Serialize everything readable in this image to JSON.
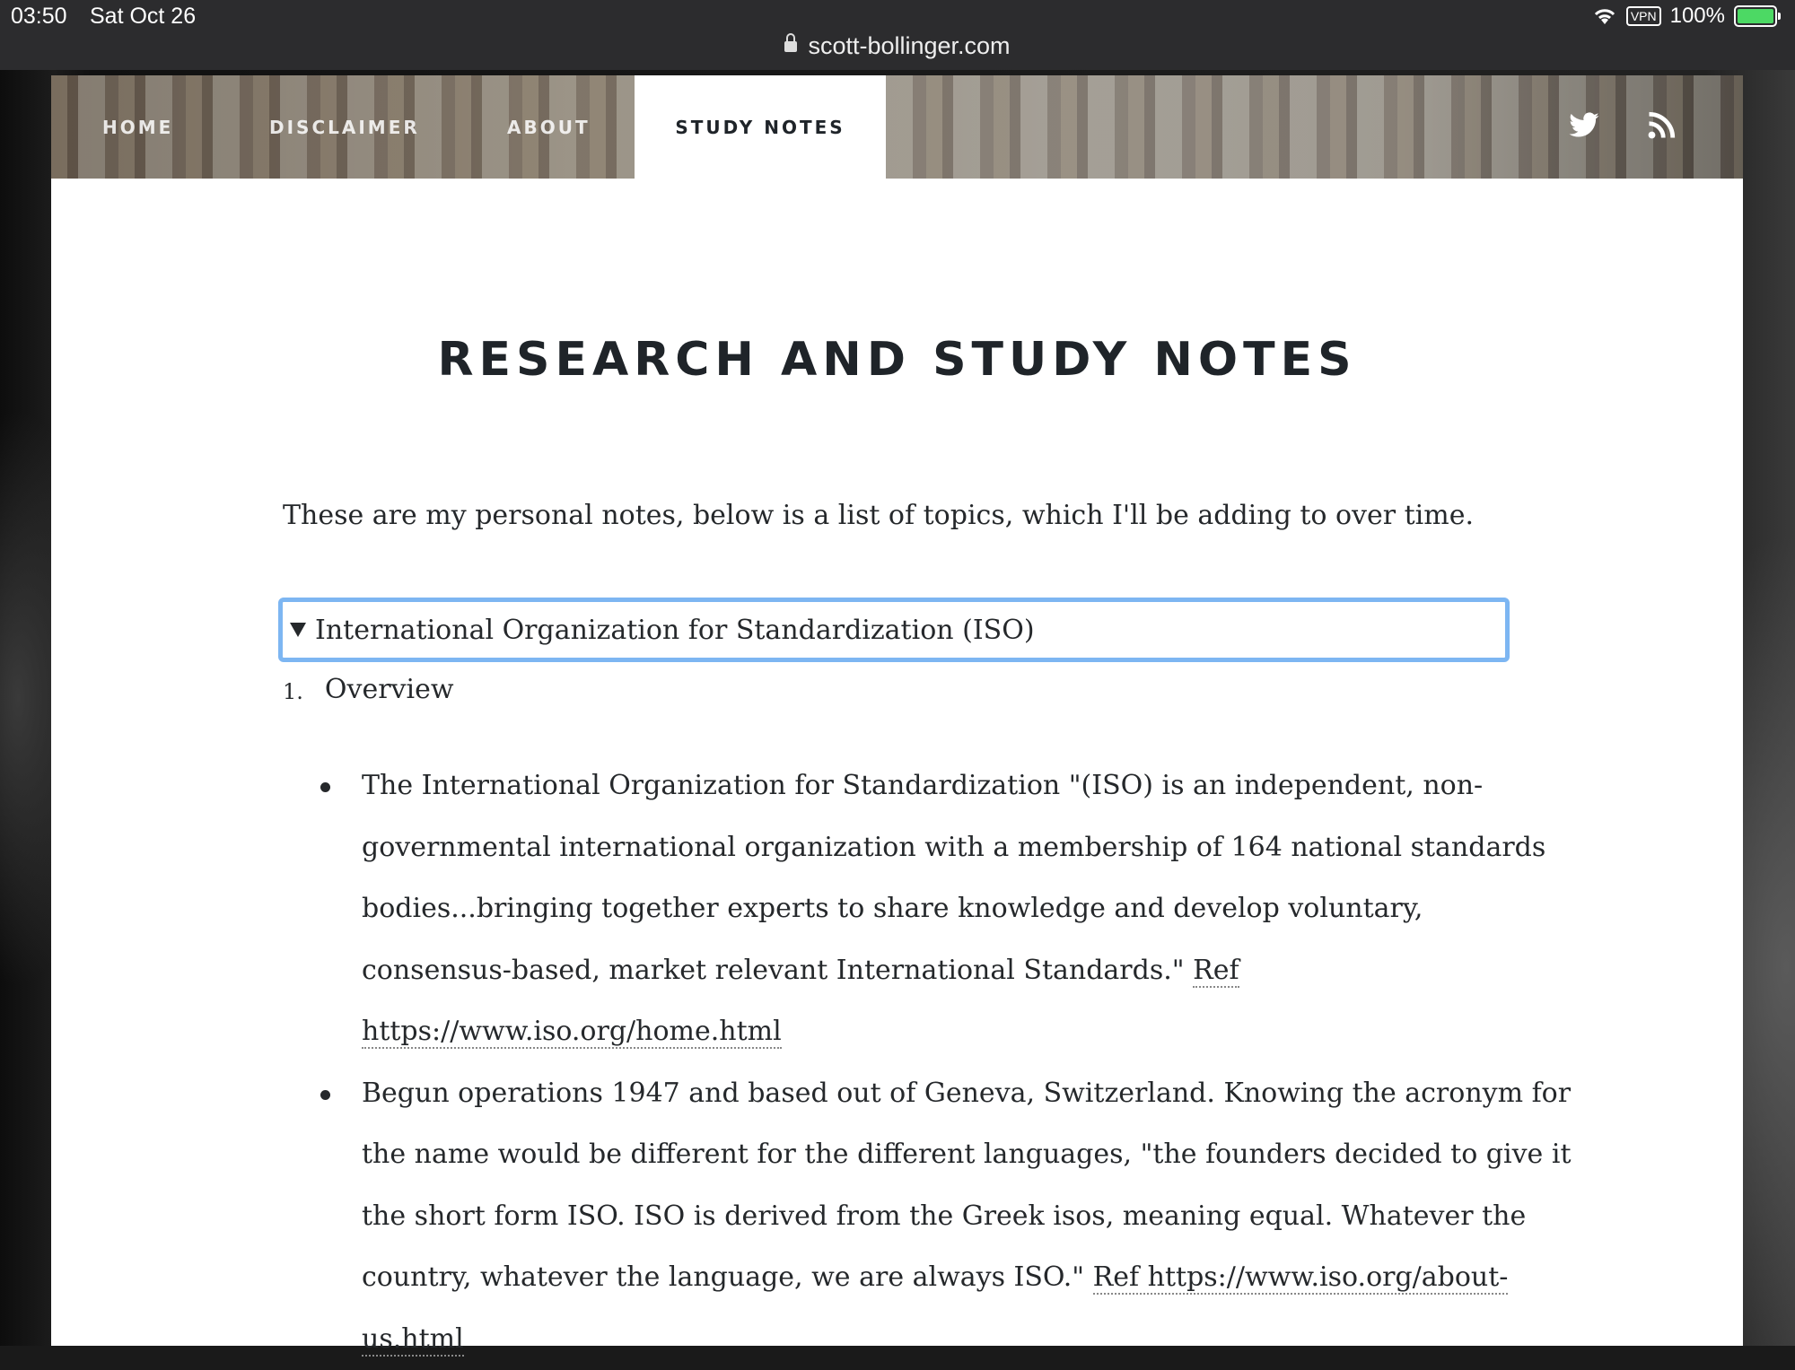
{
  "status_bar": {
    "time": "03:50",
    "date": "Sat Oct 26",
    "url": "scott-bollinger.com",
    "vpn": "VPN",
    "battery": "100%"
  },
  "nav": {
    "items": [
      "HOME",
      "DISCLAIMER",
      "ABOUT"
    ],
    "active": "STUDY NOTES",
    "icons": [
      "twitter-icon",
      "rss-icon"
    ]
  },
  "page": {
    "title": "RESEARCH AND STUDY NOTES",
    "intro": "These are my personal notes, below is a list of topics, which I'll be adding to over time.",
    "details_summary": "International Organization for Standardization (ISO)",
    "list_number": "1.",
    "list_item": "Overview",
    "bullets": [
      {
        "text": "The International Organization for Standardization \"(ISO) is an independent, non-governmental international organization with a membership of 164 national standards bodies...bringing together experts to share knowledge and develop voluntary, consensus-based, market relevant International Standards.\" ",
        "ref": "Ref https://www.iso.org/home.html"
      },
      {
        "text": "Begun operations 1947 and based out of Geneva, Switzerland. Knowing the acronym for the name would be different for the different languages, \"the founders decided to give it the short form ISO. ISO is derived from the Greek isos, meaning equal. Whatever the country, whatever the language, we are always ISO.\" ",
        "ref": "Ref https://www.iso.org/about-us.html"
      }
    ]
  }
}
